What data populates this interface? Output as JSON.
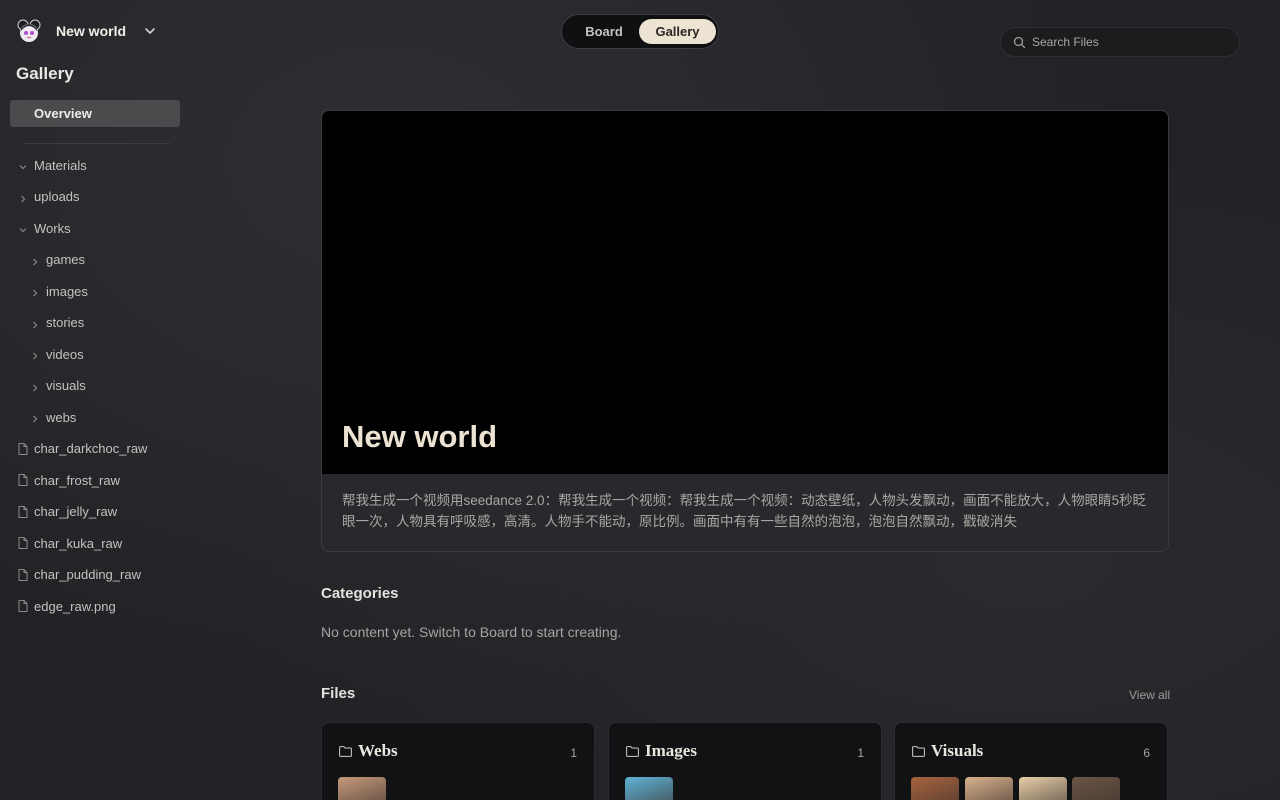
{
  "workspace": {
    "name": "New world"
  },
  "top_toggle": {
    "board_label": "Board",
    "gallery_label": "Gallery",
    "active": "Gallery"
  },
  "search": {
    "placeholder": "Search Files"
  },
  "sidebar": {
    "title": "Gallery",
    "overview_label": "Overview",
    "tree": [
      {
        "label": "Materials",
        "kind": "folder",
        "expanded": true,
        "depth": 0
      },
      {
        "label": "uploads",
        "kind": "folder",
        "expanded": false,
        "depth": 0
      },
      {
        "label": "Works",
        "kind": "folder",
        "expanded": true,
        "depth": 0
      },
      {
        "label": "games",
        "kind": "folder",
        "expanded": false,
        "depth": 1
      },
      {
        "label": "images",
        "kind": "folder",
        "expanded": false,
        "depth": 1
      },
      {
        "label": "stories",
        "kind": "folder",
        "expanded": false,
        "depth": 1
      },
      {
        "label": "videos",
        "kind": "folder",
        "expanded": false,
        "depth": 1
      },
      {
        "label": "visuals",
        "kind": "folder",
        "expanded": false,
        "depth": 1
      },
      {
        "label": "webs",
        "kind": "folder",
        "expanded": false,
        "depth": 1
      },
      {
        "label": "char_darkchoc_raw",
        "kind": "file",
        "depth": 0
      },
      {
        "label": "char_frost_raw",
        "kind": "file",
        "depth": 0
      },
      {
        "label": "char_jelly_raw",
        "kind": "file",
        "depth": 0
      },
      {
        "label": "char_kuka_raw",
        "kind": "file",
        "depth": 0
      },
      {
        "label": "char_pudding_raw",
        "kind": "file",
        "depth": 0
      },
      {
        "label": "edge_raw.png",
        "kind": "file",
        "depth": 0
      }
    ]
  },
  "hero": {
    "title": "New world",
    "description": "帮我生成一个视频用seedance 2.0：帮我生成一个视频：帮我生成一个视频：动态壁纸，人物头发飘动，画面不能放大，人物眼睛5秒眨眼一次，人物具有呼吸感，高清。人物手不能动，原比例。画面中有有一些自然的泡泡，泡泡自然飘动，戳破消失"
  },
  "categories": {
    "title": "Categories",
    "empty_text": "No content yet. Switch to Board to start creating."
  },
  "files": {
    "title": "Files",
    "view_all_label": "View all",
    "folders": [
      {
        "name": "Webs",
        "count": "1",
        "thumbs": [
          "#c79a7b"
        ]
      },
      {
        "name": "Images",
        "count": "1",
        "thumbs": [
          "#5fb2d6"
        ]
      },
      {
        "name": "Visuals",
        "count": "6",
        "thumbs": [
          "#a8643f",
          "#d8b18c",
          "#e8cfa8",
          "#6b5546"
        ]
      }
    ]
  },
  "colors": {
    "accent": "#ece3d2",
    "background": "#202225",
    "overview_active_bg": "#4a4b4d",
    "hero_media_bg": "#000000"
  }
}
